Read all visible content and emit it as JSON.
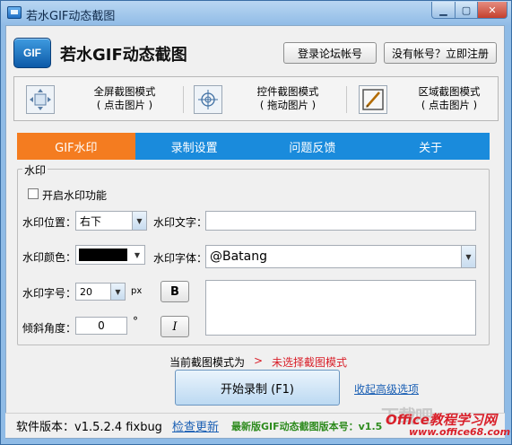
{
  "window": {
    "title": "若水GIF动态截图"
  },
  "header": {
    "logo_text": "GIF",
    "app_title": "若水GIF动态截图",
    "login_label": "登录论坛帐号",
    "register_label": "没有帐号？立即注册"
  },
  "modes": [
    {
      "line1": "全屏截图模式",
      "line2": "( 点击图片 )",
      "icon": "fullscreen-capture-icon"
    },
    {
      "line1": "控件截图模式",
      "line2": "( 拖动图片 )",
      "icon": "crosshair-capture-icon"
    },
    {
      "line1": "区域截图模式",
      "line2": "( 点击图片 )",
      "icon": "region-capture-icon"
    }
  ],
  "tabs": [
    "GIF水印",
    "录制设置",
    "问题反馈",
    "关于"
  ],
  "watermark": {
    "group_title": "水印",
    "enable_label": "开启水印功能",
    "position_label": "水印位置：",
    "position_value": "右下",
    "text_label": "水印文字：",
    "text_value": "",
    "color_label": "水印颜色：",
    "color_value": "#000000",
    "font_label": "水印字体：",
    "font_value": "@Batang",
    "size_label": "水印字号：",
    "size_value": "20",
    "size_unit": "px",
    "angle_label": "倾斜角度：",
    "angle_value": "0",
    "angle_unit": "°",
    "bold_label": "B",
    "italic_label": "I"
  },
  "status": {
    "mode_prefix": "当前截图模式为",
    "mode_arrow": ">",
    "mode_value": "未选择截图模式",
    "start_label": "开始录制 (F1)",
    "advanced_link": "收起高级选项"
  },
  "footer": {
    "version": "软件版本：v1.5.2.4 fixbug",
    "check_update": "检查更新",
    "latest": "最新版GIF动态截图版本号：v1.5",
    "wm_main": "下载吧",
    "wm_brand": "Office教程学习网",
    "wm_url": "www.office68.com"
  },
  "colors": {
    "tab_bg": "#1a8bdc",
    "tab_active": "#f47c20",
    "warn_red": "#d9202a",
    "link_blue": "#1a5fb4",
    "latest_green": "#2e8b1e"
  }
}
